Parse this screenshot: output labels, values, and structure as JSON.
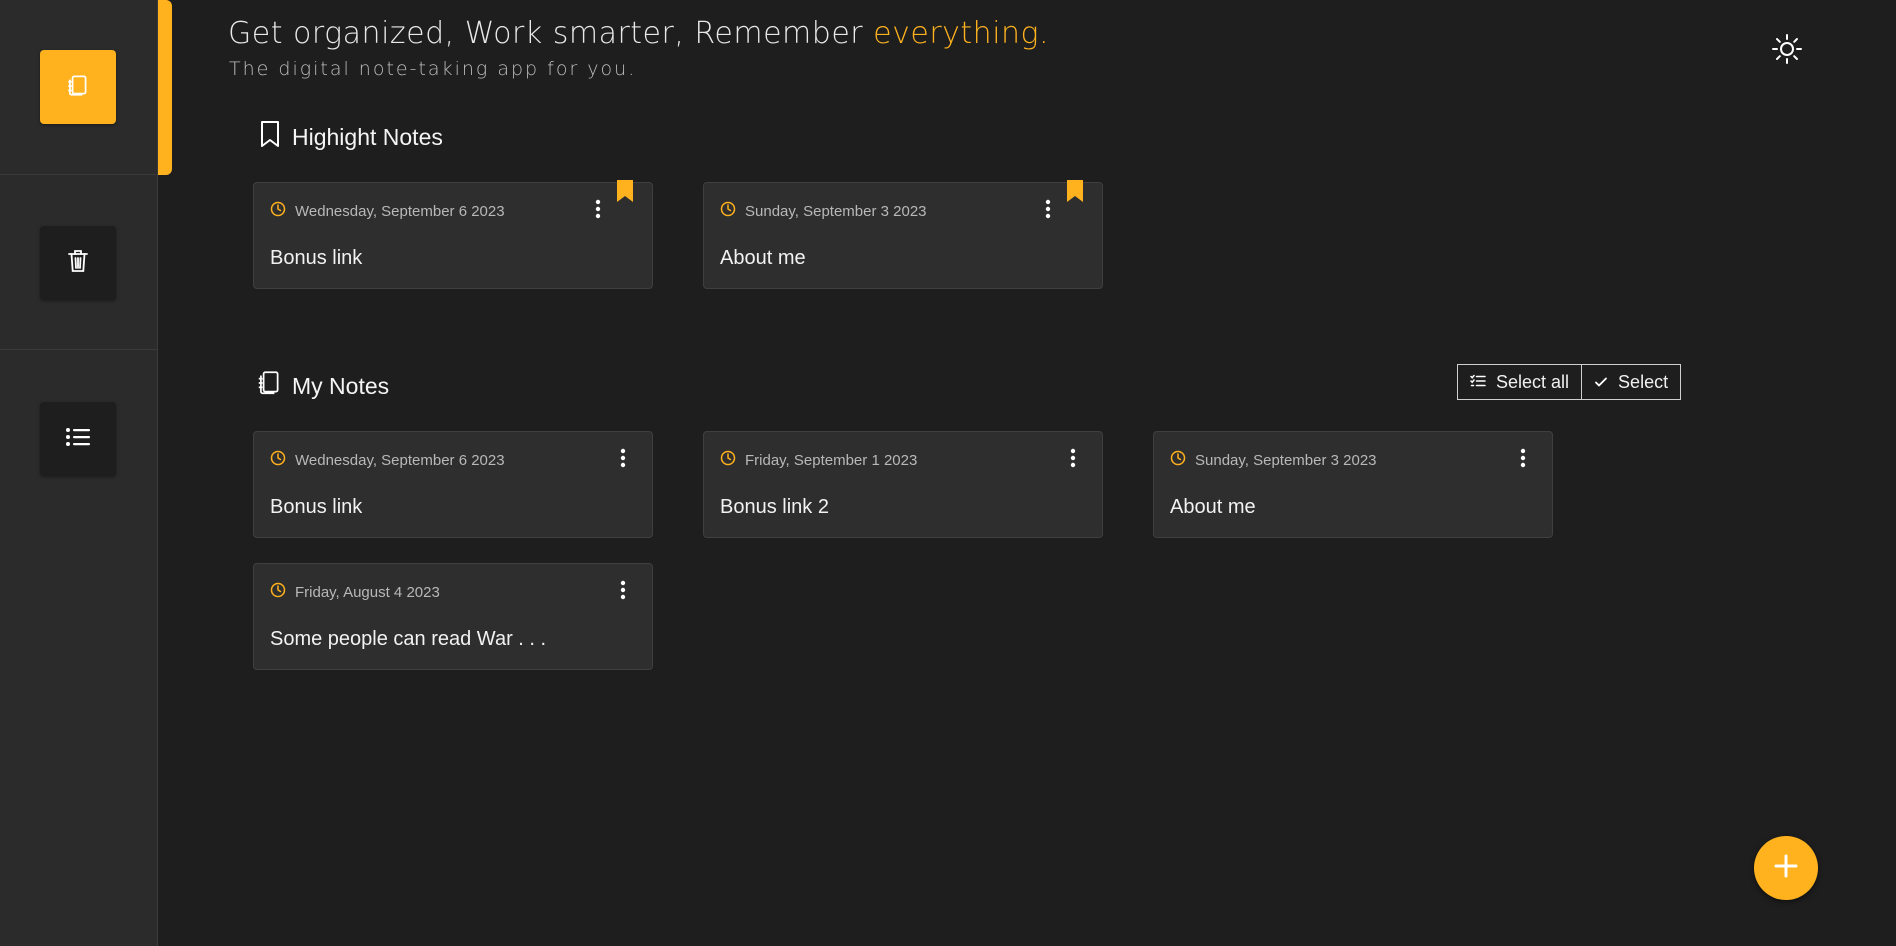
{
  "header": {
    "headline_main": "Get organized, Work smarter, Remember ",
    "headline_accent": "everything.",
    "subline": "The digital note-taking app for you.",
    "theme_icon": "sun-icon"
  },
  "sidebar": {
    "items": [
      {
        "name": "notes",
        "icon": "notes-icon",
        "active": true
      },
      {
        "name": "trash",
        "icon": "trash-icon",
        "active": false
      },
      {
        "name": "list",
        "icon": "list-icon",
        "active": false
      }
    ]
  },
  "highlight": {
    "title": "Highight Notes",
    "notes": [
      {
        "date": "Wednesday, September 6 2023",
        "title": "Bonus link"
      },
      {
        "date": "Sunday, September 3 2023",
        "title": "About me"
      }
    ]
  },
  "my_notes": {
    "title": "My Notes",
    "select_all_label": "Select all",
    "select_label": "Select",
    "notes": [
      {
        "date": "Wednesday, September 6 2023",
        "title": "Bonus link"
      },
      {
        "date": "Friday, September 1 2023",
        "title": "Bonus link 2"
      },
      {
        "date": "Sunday, September 3 2023",
        "title": "About me"
      },
      {
        "date": "Friday, August 4 2023",
        "title": "Some people can read War . . ."
      }
    ]
  },
  "colors": {
    "accent": "#ffb21e",
    "background": "#1e1e1e",
    "sidebar": "#2b2b2b",
    "card": "#2e2e2e"
  }
}
